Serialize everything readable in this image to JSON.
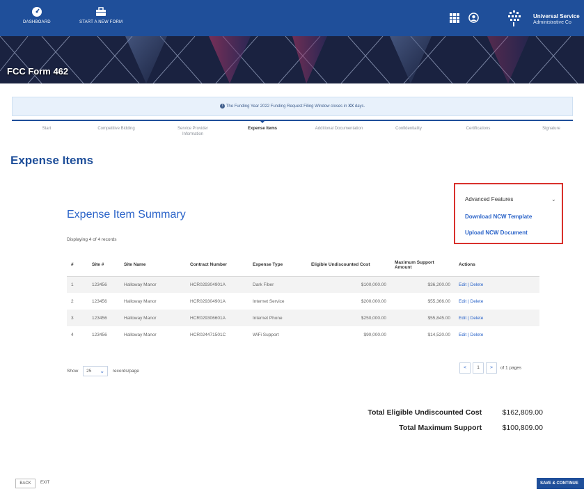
{
  "header": {
    "dashboard_label": "DASHBOARD",
    "new_form_label": "START A NEW FORM",
    "org_line1": "Universal Service",
    "org_line2": "Administrative Co"
  },
  "banner": {
    "title": "FCC Form 462"
  },
  "notice": {
    "prefix": "The Funding Year 2022 Funding Request Filing Window closes in ",
    "days": "XX",
    "suffix": " days."
  },
  "steps": [
    {
      "label": "Start"
    },
    {
      "label": "Competitive Bidding"
    },
    {
      "label": "Service Provider Information"
    },
    {
      "label": "Expense Items"
    },
    {
      "label": "Additional Documentation"
    },
    {
      "label": "Confidentiality"
    },
    {
      "label": "Certifications"
    },
    {
      "label": "Signature"
    }
  ],
  "page_title": "Expense Items",
  "advanced": {
    "heading": "Advanced Features",
    "link1": "Download NCW Template",
    "link2": "Upload NCW Document"
  },
  "summary": {
    "title": "Expense Item Summary",
    "count": "Displaying 4 of 4 records",
    "columns": [
      "#",
      "Site #",
      "Site Name",
      "Contract Number",
      "Expense Type",
      "Eligible Undiscounted Cost",
      "Maximum Support Amount",
      "Actions"
    ],
    "rows": [
      {
        "n": "1",
        "site": "123456",
        "name": "Halloway Manor",
        "contract": "HCR029304901A",
        "type": "Dark Fiber",
        "cost": "$100,000.00",
        "support": "$36,200.00"
      },
      {
        "n": "2",
        "site": "123456",
        "name": "Halloway Manor",
        "contract": "HCR029304901A",
        "type": "Internet Service",
        "cost": "$200,000.00",
        "support": "$55,366.00"
      },
      {
        "n": "3",
        "site": "123456",
        "name": "Halloway Manor",
        "contract": "HCR029306601A",
        "type": "Internet Phone",
        "cost": "$250,000.00",
        "support": "$55,845.00"
      },
      {
        "n": "4",
        "site": "123456",
        "name": "Halloway Manor",
        "contract": "HCR024471501C",
        "type": "WiFi Support",
        "cost": "$90,000.00",
        "support": "$14,520.00"
      }
    ],
    "edit_label": "Edit",
    "sep": "|",
    "delete_label": "Delete"
  },
  "pager": {
    "show_label": "Show",
    "per_page": "25",
    "per_page_label": "records/page",
    "prev": "<",
    "page": "1",
    "next": ">",
    "of_pages": "of 1 pages"
  },
  "totals": {
    "eligible_label": "Total Eligible Undiscounted Cost",
    "eligible_value": "$162,809.00",
    "support_label": "Total Maximum Support",
    "support_value": "$100,809.00"
  },
  "footer": {
    "back": "BACK",
    "exit": "EXIT",
    "save": "SAVE & CONTINUE"
  },
  "colors": {
    "brand": "#1f4f9a",
    "link": "#2a63c8",
    "highlight": "#d9312c"
  }
}
